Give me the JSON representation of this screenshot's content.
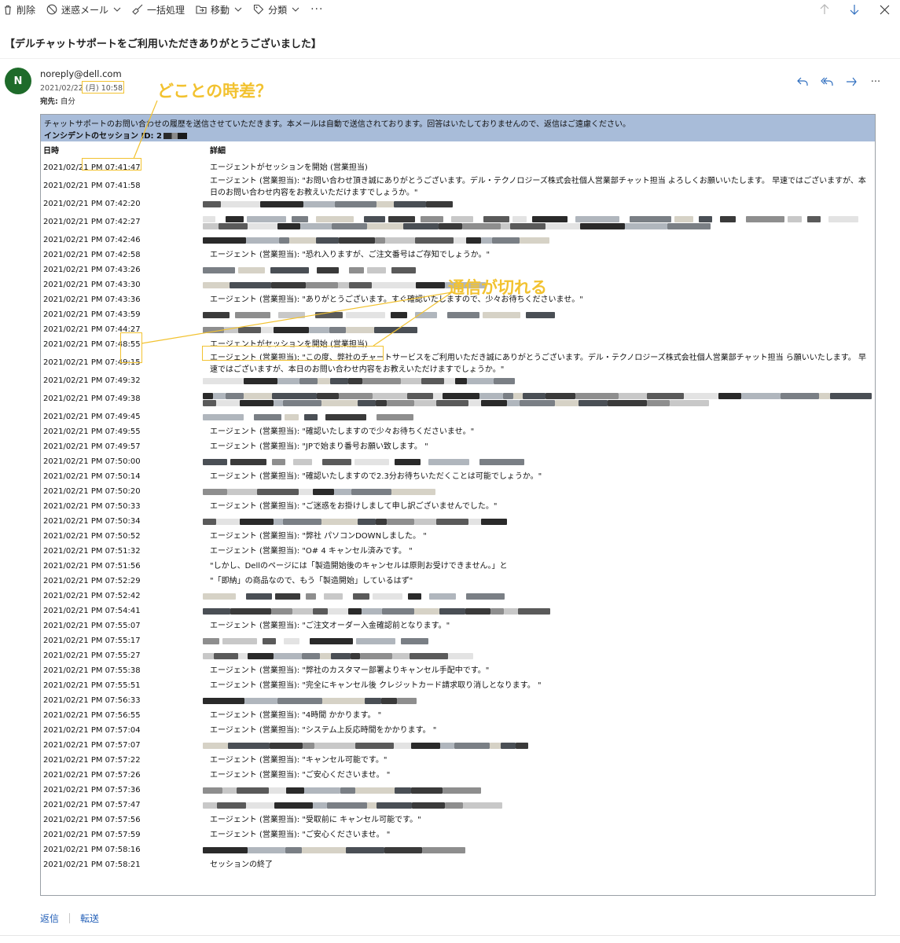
{
  "toolbar": {
    "delete_label": "削除",
    "junk_label": "迷惑メール",
    "sweep_label": "一括処理",
    "move_label": "移動",
    "categorize_label": "分類",
    "more_label": "···"
  },
  "email": {
    "subject": "【デルチャットサポートをご利用いただきありがとうございました】",
    "avatar_initial": "N",
    "sender": "noreply@dell.com",
    "date_prefix": "2021/02/",
    "date_highlight": "22 (月) 10:58",
    "to_label": "宛先:",
    "to_value": "自分"
  },
  "body": {
    "banner_line1": "チャットサポートのお問い合わせの履歴を送信させていただきます。本メールは自動で送信されております。回答はいたしておりませんので、返信はご遠慮ください。",
    "banner_line2": "インシデントのセッション ID: 2",
    "col_date": "日時",
    "col_detail": "詳細",
    "rows": [
      {
        "time": "2021/02/21 PM 07:41:47",
        "detail": "エージェントがセッションを開始 (営業担当)"
      },
      {
        "time": "2021/02/21 PM 07:41:58",
        "detail": "エージェント (営業担当): \"お問い合わせ頂き誠にありがとうございます。デル・テクノロジーズ株式会社個人営業部チャット担当                                よろしくお願いいたします。 早速ではございますが、本日のお問い合わせ内容をお教えいただけますでしょうか。\""
      },
      {
        "time": "2021/02/21 PM 07:42:20",
        "detail": ""
      },
      {
        "time": "2021/02/21 PM 07:42:27",
        "detail": ""
      },
      {
        "time": "2021/02/21 PM 07:42:46",
        "detail": ""
      },
      {
        "time": "2021/02/21 PM 07:42:58",
        "detail": "エージェント (営業担当): \"恐れ入りますが、ご注文番号はご存知でしょうか。\""
      },
      {
        "time": "2021/02/21 PM 07:43:26",
        "detail": ""
      },
      {
        "time": "2021/02/21 PM 07:43:30",
        "detail": ""
      },
      {
        "time": "2021/02/21 PM 07:43:36",
        "detail": "エージェント (営業担当): \"ありがとうございます。すぐ確認いたしますので、少々お待ちくださいませ。\""
      },
      {
        "time": "2021/02/21 PM 07:43:59",
        "detail": ""
      },
      {
        "time": "2021/02/21 PM 07:44:27",
        "detail": ""
      },
      {
        "time": "2021/02/21 PM 07:48:55",
        "detail": "エージェントがセッションを開始 (営業担当)"
      },
      {
        "time": "2021/02/21 PM 07:49:15",
        "detail": "エージェント (営業担当): \"この度、弊社のチャートサービスをご利用いただき誠にありがとうございます。デル・テクノロジーズ株式会社個人営業部チャット担当                       ら願いいたします。 早速ではございますが、本日のお問い合わせ内容をお教えいただけますでしょうか。\""
      },
      {
        "time": "2021/02/21 PM 07:49:32",
        "detail": ""
      },
      {
        "time": "2021/02/21 PM 07:49:38",
        "detail": ""
      },
      {
        "time": "2021/02/21 PM 07:49:45",
        "detail": ""
      },
      {
        "time": "2021/02/21 PM 07:49:55",
        "detail": "エージェント (営業担当): \"確認いたしますので少々お待ちくださいませ。\""
      },
      {
        "time": "2021/02/21 PM 07:49:57",
        "detail": "エージェント (営業担当): \"JPで始まり番号お願い致します。   \""
      },
      {
        "time": "2021/02/21 PM 07:50:00",
        "detail": ""
      },
      {
        "time": "2021/02/21 PM 07:50:14",
        "detail": "エージェント (営業担当): \"確認いたしますので2.3分お待ちいただくことは可能でしょうか。\""
      },
      {
        "time": "2021/02/21 PM 07:50:20",
        "detail": ""
      },
      {
        "time": "2021/02/21 PM 07:50:33",
        "detail": "エージェント (営業担当): \"ご迷惑をお掛けしまして申し訳ございませんでした。\""
      },
      {
        "time": "2021/02/21 PM 07:50:34",
        "detail": ""
      },
      {
        "time": "2021/02/21 PM 07:50:52",
        "detail": "エージェント (営業担当): \"弊社    パソコンDOWNしました。   \""
      },
      {
        "time": "2021/02/21 PM 07:51:32",
        "detail": "エージェント (営業担当): \"O#           4   キャンセル済みです。   \""
      },
      {
        "time": "2021/02/21 PM 07:51:56",
        "detail": "      \"しかし、Dellのページには「製造開始後のキャンセルは原則お受けできません。」と"
      },
      {
        "time": "2021/02/21 PM 07:52:29",
        "detail": "     \"「即納」の商品なので、もう「製造開始」しているはず\""
      },
      {
        "time": "2021/02/21 PM 07:52:42",
        "detail": ""
      },
      {
        "time": "2021/02/21 PM 07:54:41",
        "detail": ""
      },
      {
        "time": "2021/02/21 PM 07:55:07",
        "detail": "エージェント (営業担当): \"ご注文オーダー入金確認前となります。\""
      },
      {
        "time": "2021/02/21 PM 07:55:17",
        "detail": ""
      },
      {
        "time": "2021/02/21 PM 07:55:27",
        "detail": ""
      },
      {
        "time": "2021/02/21 PM 07:55:38",
        "detail": "エージェント (営業担当): \"弊社のカスタマー部署よりキャンセル手配中です。\""
      },
      {
        "time": "2021/02/21 PM 07:55:51",
        "detail": "エージェント (営業担当): \"完全にキャンセル後  クレジットカード請求取り消しとなります。   \""
      },
      {
        "time": "2021/02/21 PM 07:56:33",
        "detail": ""
      },
      {
        "time": "2021/02/21 PM 07:56:55",
        "detail": "エージェント (営業担当): \"4時間  かかります。   \""
      },
      {
        "time": "2021/02/21 PM 07:57:04",
        "detail": "エージェント (営業担当): \"システム上反応時間をかかります。   \""
      },
      {
        "time": "2021/02/21 PM 07:57:07",
        "detail": ""
      },
      {
        "time": "2021/02/21 PM 07:57:22",
        "detail": "エージェント (営業担当): \"キャンセル可能です。\""
      },
      {
        "time": "2021/02/21 PM 07:57:26",
        "detail": "エージェント (営業担当): \"ご安心くださいませ。   \""
      },
      {
        "time": "2021/02/21 PM 07:57:36",
        "detail": ""
      },
      {
        "time": "2021/02/21 PM 07:57:47",
        "detail": ""
      },
      {
        "time": "2021/02/21 PM 07:57:56",
        "detail": "エージェント (営業担当): \"受取前に  キャンセル可能です。\""
      },
      {
        "time": "2021/02/21 PM 07:57:59",
        "detail": "エージェント (営業担当): \"ご安心くださいませ。   \""
      },
      {
        "time": "2021/02/21 PM 07:58:16",
        "detail": ""
      },
      {
        "time": "2021/02/21 PM 07:58:21",
        "detail": "セッションの終了"
      }
    ]
  },
  "annotations": {
    "timezone_question": "どことの時差？",
    "connection_lost": "通信が切れる"
  },
  "footer": {
    "reply_label": "返信",
    "forward_label": "転送"
  },
  "colors": {
    "banner_bg": "#a8bcd9",
    "avatar_bg": "#1e6b2a",
    "annotation": "#f2c230",
    "link": "#2460b8",
    "toolbar_icon": "#2f6ebf"
  }
}
